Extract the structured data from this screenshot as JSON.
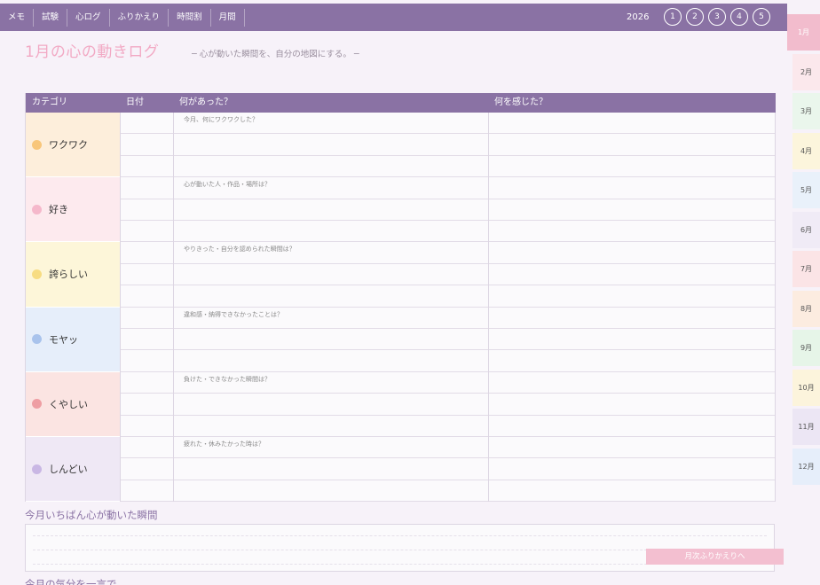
{
  "nav": {
    "tabs": [
      "メモ",
      "試験",
      "心ログ",
      "ふりかえり",
      "時間割",
      "月間"
    ]
  },
  "year": "2026",
  "weeks": [
    "1",
    "2",
    "3",
    "4",
    "5"
  ],
  "page": {
    "title": "1月の心の動きログ",
    "subtitle": "─ 心が動いた瞬間を、自分の地図にする。 ─"
  },
  "table": {
    "headers": {
      "category": "カテゴリ",
      "date": "日付",
      "what": "何があった？",
      "feel": "何を感じた？"
    },
    "rows": [
      {
        "label": "ワクワク",
        "prompt": "今月、何にワクワクした？",
        "dot": "#f8c67a",
        "bg": "#fdeedb"
      },
      {
        "label": "好き",
        "prompt": "心が動いた人・作品・場所は？",
        "dot": "#f5b8cb",
        "bg": "#fdeaee"
      },
      {
        "label": "誇らしい",
        "prompt": "やりきった・自分を認められた瞬間は？",
        "dot": "#f7dc82",
        "bg": "#fdf6d9"
      },
      {
        "label": "モヤッ",
        "prompt": "違和感・納得できなかったことは？",
        "dot": "#a9c3ec",
        "bg": "#e6eefa"
      },
      {
        "label": "くやしい",
        "prompt": "負けた・できなかった瞬間は？",
        "dot": "#ee9ea3",
        "bg": "#fbe4e2"
      },
      {
        "label": "しんどい",
        "prompt": "疲れた・休みたかった時は？",
        "dot": "#c9b7e4",
        "bg": "#efe8f5"
      }
    ]
  },
  "memo": {
    "title": "今月いちばん心が動いた瞬間",
    "button": "月次ふりかえりへ"
  },
  "section2": {
    "title": "今月の気分を一言で"
  },
  "months": [
    {
      "label": "1月",
      "color": "#f2bccd"
    },
    {
      "label": "2月",
      "color": "#fbe8ec"
    },
    {
      "label": "3月",
      "color": "#eaf6ec"
    },
    {
      "label": "4月",
      "color": "#fcf5dc"
    },
    {
      "label": "5月",
      "color": "#e9f1fa"
    },
    {
      "label": "6月",
      "color": "#f0ebf6"
    },
    {
      "label": "7月",
      "color": "#fbe4e6"
    },
    {
      "label": "8月",
      "color": "#fcece0"
    },
    {
      "label": "9月",
      "color": "#e6f5e8"
    },
    {
      "label": "10月",
      "color": "#fcf4dc"
    },
    {
      "label": "11月",
      "color": "#ece6f4"
    },
    {
      "label": "12月",
      "color": "#e6eefa"
    }
  ]
}
